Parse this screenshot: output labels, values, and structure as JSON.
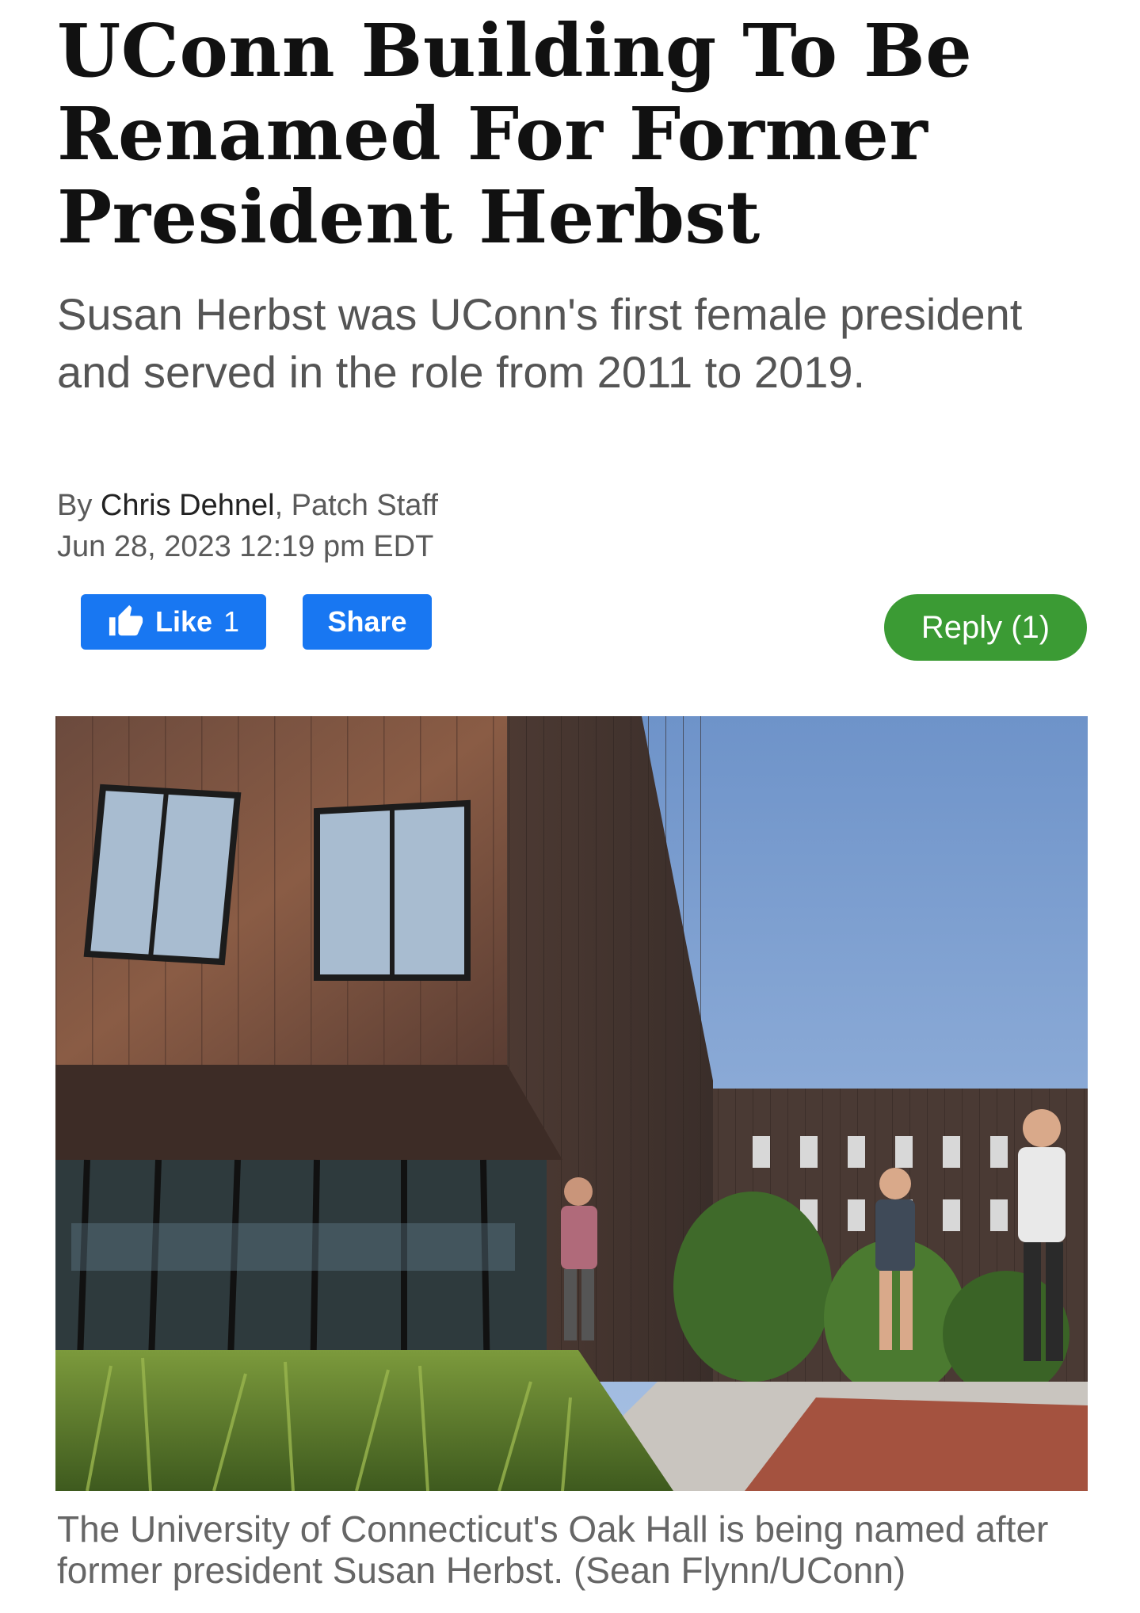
{
  "article": {
    "headline": "UConn Building To Be Renamed For Former President Herbst",
    "dek": "Susan Herbst was UConn's first female president and served in the role from 2011 to 2019.",
    "byline_prefix": "By ",
    "author": "Chris Dehnel",
    "byline_suffix": ", Patch Staff",
    "date": "Jun 28, 2023 12:19 pm EDT"
  },
  "actions": {
    "like_label": "Like",
    "like_count": "1",
    "share_label": "Share",
    "reply_label": "Reply (1)",
    "colors": {
      "facebook": "#1877f2",
      "reply": "#3b9b34"
    }
  },
  "photo": {
    "description_icon": "photo-oak-hall",
    "caption": "The University of Connecticut's Oak Hall is being named after former president Susan Herbst. (Sean Flynn/UConn)"
  }
}
